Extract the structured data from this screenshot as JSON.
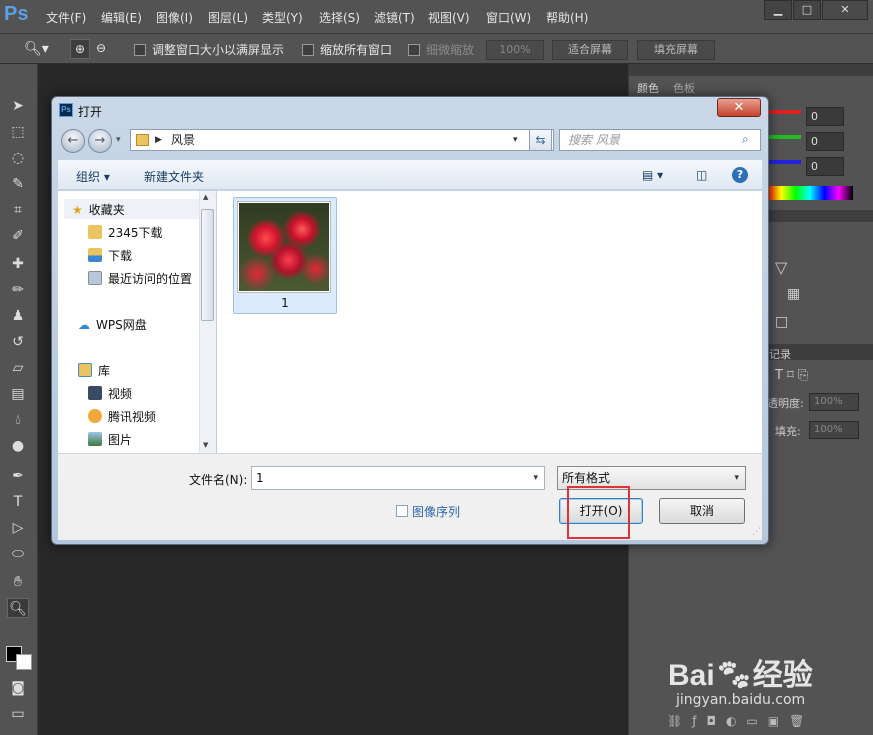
{
  "menubar": {
    "logo": "Ps",
    "items": [
      "文件(F)",
      "编辑(E)",
      "图像(I)",
      "图层(L)",
      "类型(Y)",
      "选择(S)",
      "滤镜(T)",
      "视图(V)",
      "窗口(W)",
      "帮助(H)"
    ],
    "window_buttons": [
      "▁",
      "□",
      "✕"
    ]
  },
  "options_bar": {
    "resize_windows_label": "调整窗口大小以满屏显示",
    "zoom_all_label": "缩放所有窗口",
    "scrubby_zoom_label": "细微缩放",
    "zoom_value": "100%",
    "fit_screen_label": "适合屏幕",
    "fill_screen_label": "填充屏幕"
  },
  "panels": {
    "tab_color": "颜色",
    "tab_swatches": "色板",
    "rgb_values": [
      "0",
      "0",
      "0"
    ],
    "history_tab": "记录",
    "opacity_label": "透明度:",
    "opacity_value": "100%",
    "fill_label": "填充:",
    "fill_value": "100%"
  },
  "dialog": {
    "title": "打开",
    "close_label": "✕",
    "address": "风景",
    "search_placeholder": "搜索 风景",
    "toolbar": {
      "organize": "组织 ▾",
      "new_folder": "新建文件夹"
    },
    "nav": {
      "favorites": "收藏夹",
      "items": [
        "2345下载",
        "下载",
        "最近访问的位置"
      ],
      "wps": "WPS网盘",
      "library": "库",
      "library_items": [
        "视频",
        "腾讯视频",
        "图片"
      ]
    },
    "files": [
      {
        "name": "1"
      }
    ],
    "filename_label": "文件名(N):",
    "filename_value": "1",
    "format_value": "所有格式",
    "image_sequence_label": "图像序列",
    "open_button": "打开(O)",
    "cancel_button": "取消"
  },
  "colors": {
    "highlight": "#e0323a",
    "ps_blue": "#5aa0e6"
  }
}
